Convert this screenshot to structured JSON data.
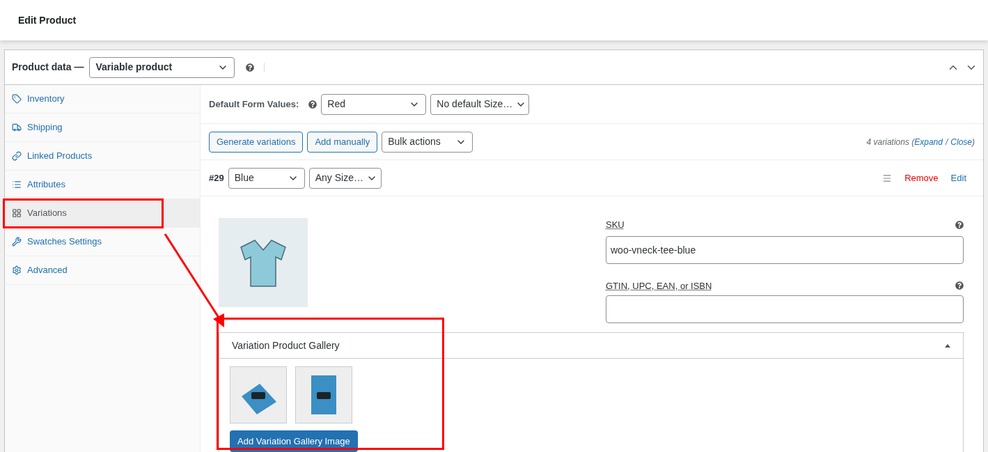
{
  "page": {
    "title": "Edit Product"
  },
  "product_data": {
    "label": "Product data —",
    "type": "Variable product"
  },
  "tabs": [
    {
      "label": "Inventory",
      "selected": false
    },
    {
      "label": "Shipping",
      "selected": false
    },
    {
      "label": "Linked Products",
      "selected": false
    },
    {
      "label": "Attributes",
      "selected": false
    },
    {
      "label": "Variations",
      "selected": true
    },
    {
      "label": "Swatches Settings",
      "selected": false
    },
    {
      "label": "Advanced",
      "selected": false
    }
  ],
  "defaults": {
    "label": "Default Form Values:",
    "selects": [
      "Red",
      "No default Size…"
    ]
  },
  "toolbar": {
    "buttons": [
      "Generate variations",
      "Add manually"
    ],
    "bulk": "Bulk actions",
    "count": "4 variations (",
    "links": [
      "Expand",
      "Close"
    ],
    "separator": "/",
    "suffix": ")"
  },
  "variation": {
    "number": "#29",
    "selects": [
      "Blue",
      "Any Size…"
    ],
    "remove": "Remove",
    "edit": "Edit",
    "sku_label": "SKU",
    "sku": "woo-vneck-tee-blue",
    "gtin_label": "GTIN, UPC, EAN, or ISBN",
    "gallery": {
      "title": "Variation Product Gallery",
      "images": [
        {
          "kind": "flat"
        },
        {
          "kind": "held"
        }
      ],
      "button": "Add Variation Gallery Image"
    }
  }
}
